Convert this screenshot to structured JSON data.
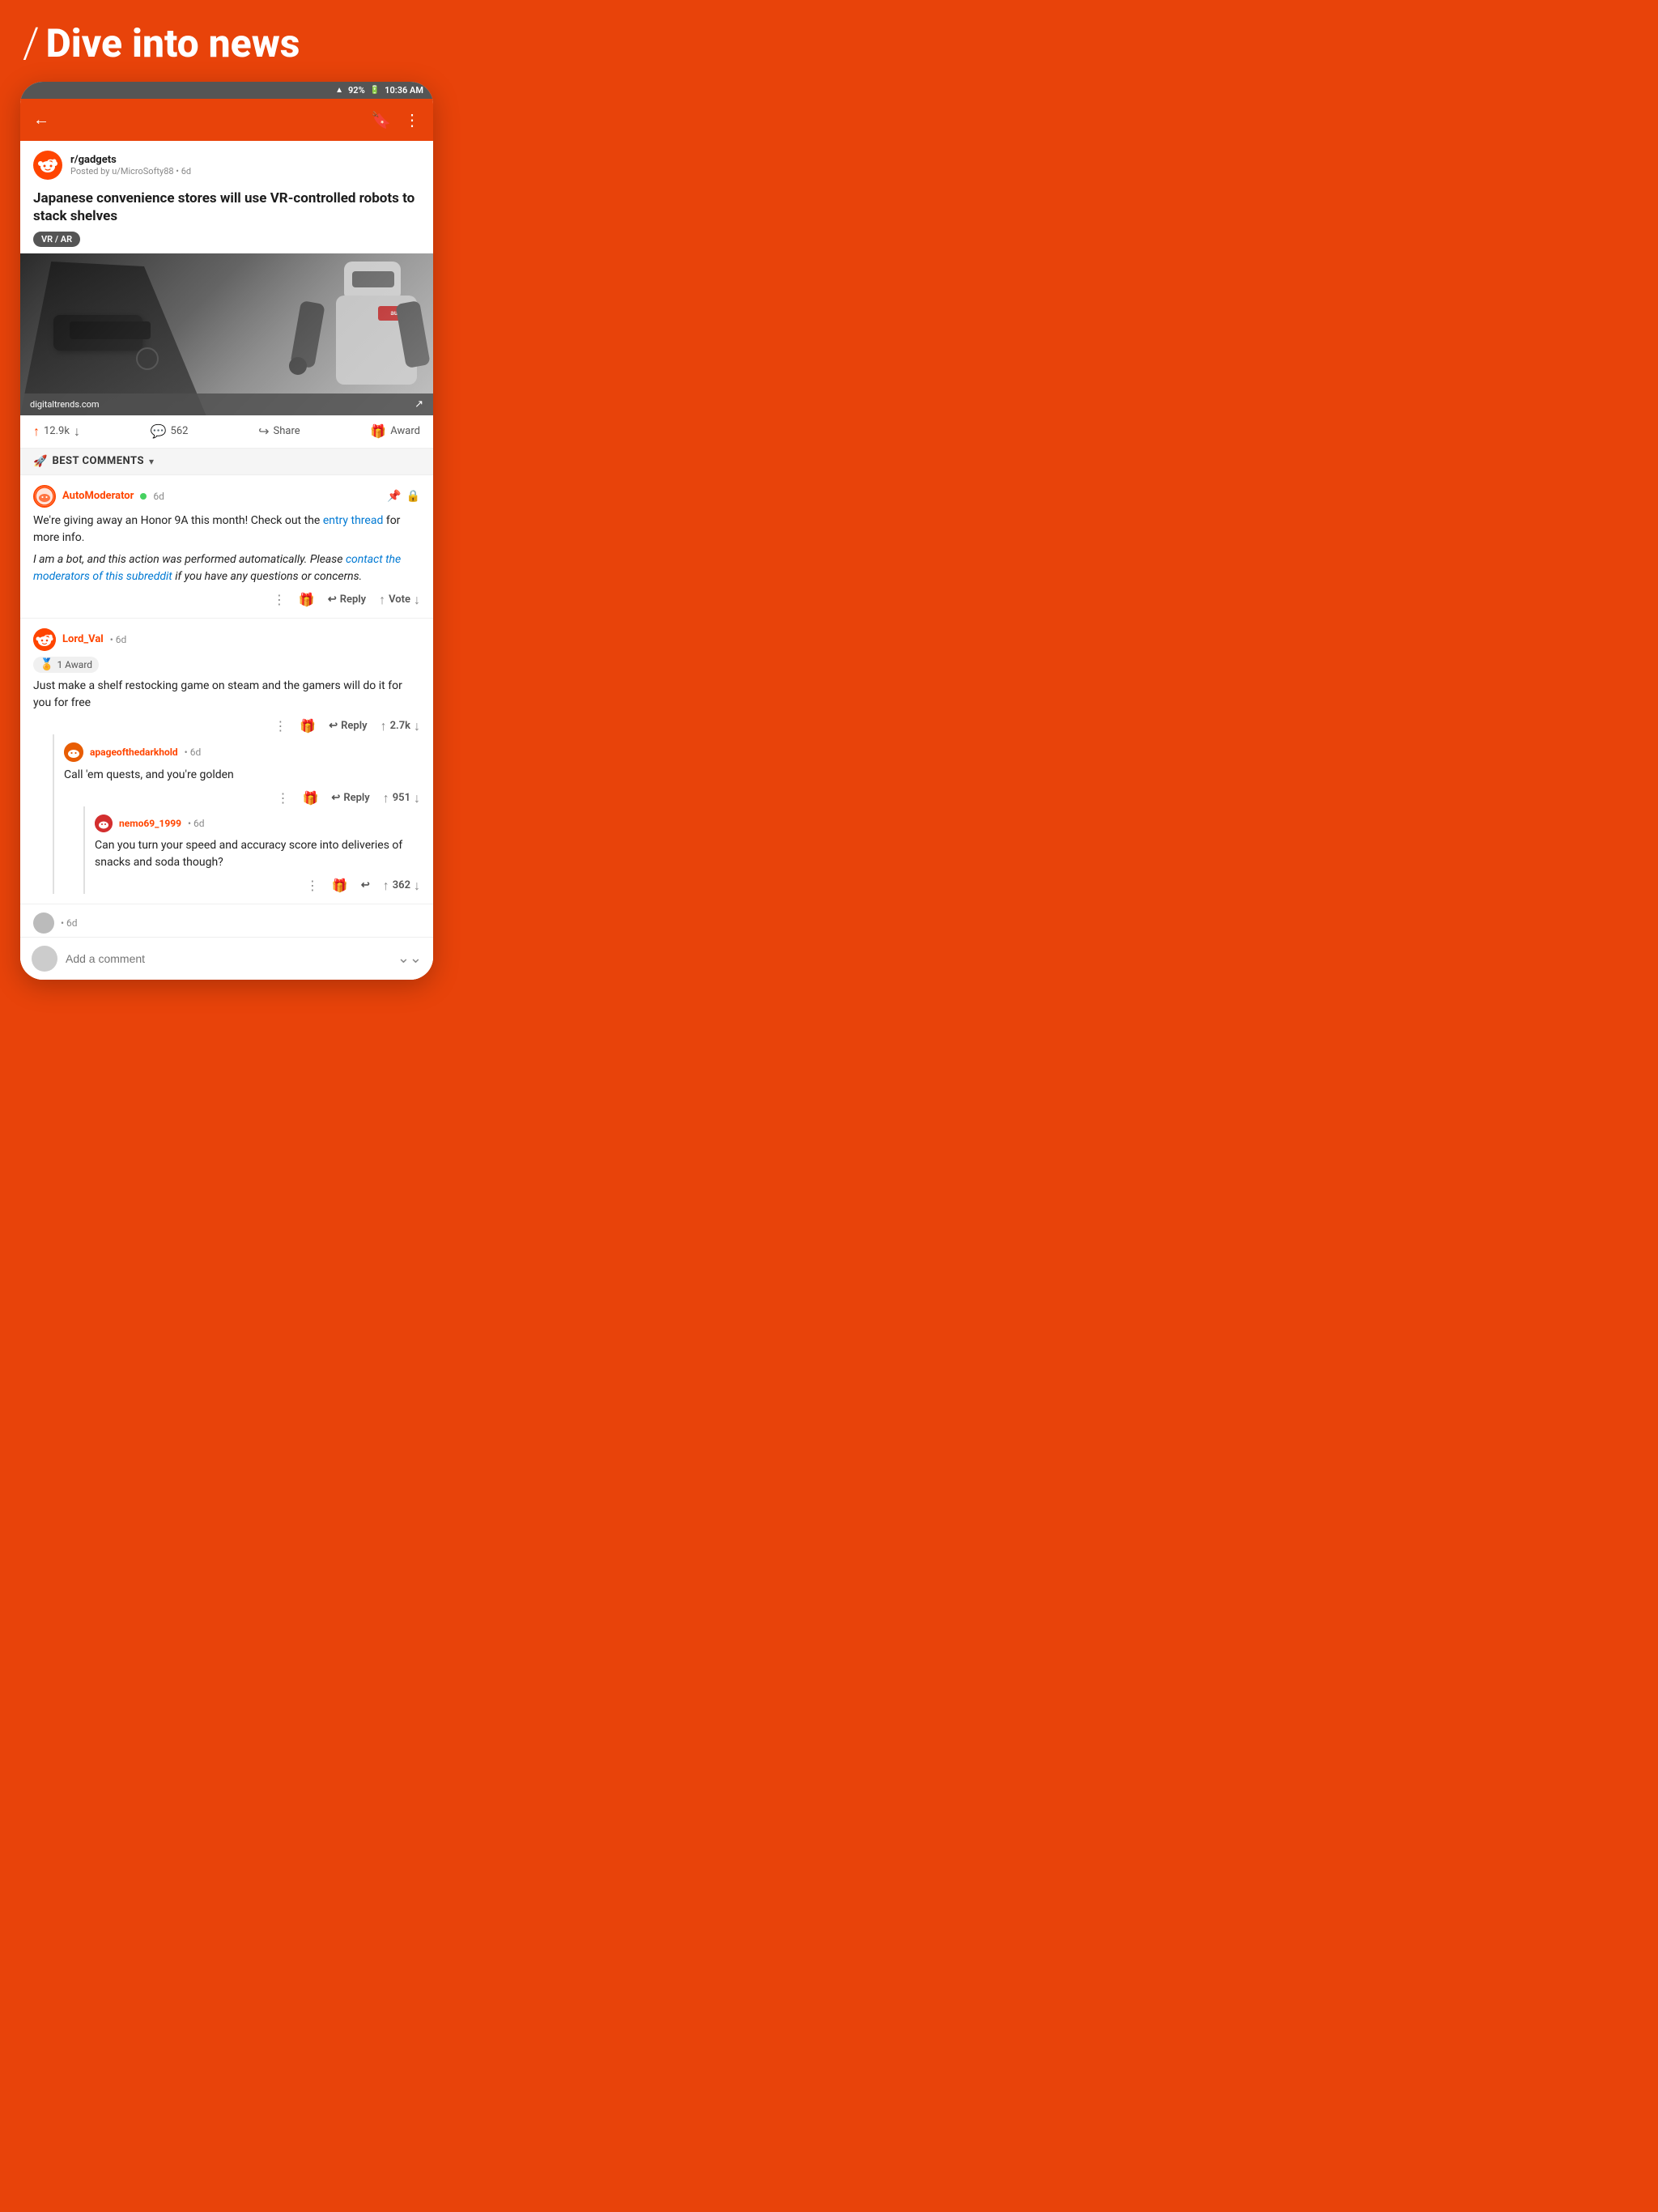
{
  "header": {
    "slash": "/",
    "title": "Dive into news"
  },
  "status_bar": {
    "wifi": "wifi",
    "battery": "92%",
    "time": "10:36 AM"
  },
  "toolbar": {
    "back_icon": "←",
    "bookmark_icon": "🔖",
    "more_icon": "⋮"
  },
  "post": {
    "subreddit": "r/gadgets",
    "posted_by": "Posted by u/MicroSofty88 • 6d",
    "title": "Japanese convenience stores will use VR-controlled robots to stack shelves",
    "flair": "VR / AR",
    "image_source": "digitaltrends.com",
    "upvotes": "12.9k",
    "comments": "562",
    "share_label": "Share",
    "award_label": "Award"
  },
  "sort": {
    "icon": "🚀",
    "label": "BEST COMMENTS",
    "chevron": "▾"
  },
  "comments": [
    {
      "id": "automoderator",
      "username": "AutoModerator",
      "online": true,
      "age": "6d",
      "pinned": true,
      "locked": true,
      "text_part1": "We're giving away an Honor 9A this month! Check out the ",
      "link_text": "entry thread",
      "text_part2": " for more info.",
      "text_italic": "I am a bot, and this action was performed automatically. Please ",
      "link_italic_text": "contact the moderators of this subreddit",
      "text_italic2": " if you have any questions or concerns.",
      "reply_label": "Reply",
      "vote_label": "Vote",
      "actions": true,
      "vote_up_icon": "↑",
      "vote_down_icon": "↓"
    },
    {
      "id": "lord_val",
      "username": "Lord_Val",
      "age": "6d",
      "award": "1 Award",
      "text": "Just make a shelf restocking game on steam and the gamers will do it for you for free",
      "reply_label": "Reply",
      "vote_count": "2.7k",
      "vote_up_icon": "↑",
      "vote_down_icon": "↓",
      "nested": [
        {
          "id": "apageofthedarkhold",
          "username": "apageofthedarkhold",
          "age": "6d",
          "text": "Call 'em quests, and you're golden",
          "reply_label": "Reply",
          "vote_count": "951",
          "vote_up_icon": "↑",
          "vote_down_icon": "↓",
          "nested": [
            {
              "id": "nemo69_1999",
              "username": "nemo69_1999",
              "age": "6d",
              "text": "Can you turn your speed and accuracy score into deliveries of snacks and soda though?",
              "vote_count": "362",
              "vote_up_icon": "↑",
              "vote_down_icon": "↓"
            }
          ]
        }
      ]
    }
  ],
  "add_comment": {
    "placeholder": "Add a comment",
    "chevron": "⌄⌄"
  }
}
